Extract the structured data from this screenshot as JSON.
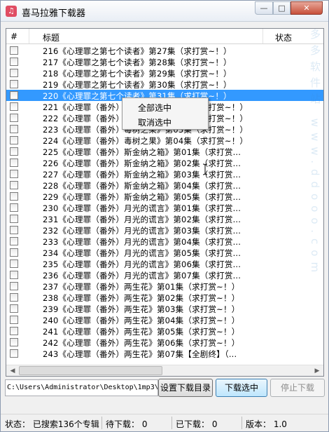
{
  "window": {
    "title": "喜马拉雅下载器",
    "min_label": "—",
    "max_label": "□",
    "close_label": "✕"
  },
  "list": {
    "columns": {
      "index": "#",
      "title": "标题",
      "status": "状态"
    },
    "rows": [
      {
        "text": "216《心理罪之第七个读者》第27集（求打赏~！）",
        "selected": false
      },
      {
        "text": "217《心理罪之第七个读者》第28集（求打赏~！）",
        "selected": false
      },
      {
        "text": "218《心理罪之第七个读者》第29集（求打赏~！）",
        "selected": false
      },
      {
        "text": "219《心理罪之第七个读者》第30集（求打赏~！）",
        "selected": false
      },
      {
        "text": "220《心理罪之第七个读者》第31集（求打赏~！）",
        "selected": true
      },
      {
        "text": "221《心理罪（番外）毒树之果》第01集（求打赏~！）",
        "selected": false
      },
      {
        "text": "222《心理罪（番外）毒树之果》第02集（求打赏~！）",
        "selected": false
      },
      {
        "text": "223《心理罪（番外）毒树之果》第03集（求打赏~！）",
        "selected": false
      },
      {
        "text": "224《心理罪（番外）毒树之果》第04集（求打赏~！）",
        "selected": false
      },
      {
        "text": "225《心理罪（番外）斯金纳之箱》第01集（求打赏...",
        "selected": false
      },
      {
        "text": "226《心理罪（番外）斯金纳之箱》第02集（求打赏...",
        "selected": false
      },
      {
        "text": "227《心理罪（番外）斯金纳之箱》第03集（求打赏...",
        "selected": false
      },
      {
        "text": "228《心理罪（番外）斯金纳之箱》第04集（求打赏...",
        "selected": false
      },
      {
        "text": "229《心理罪（番外）斯金纳之箱》第05集（求打赏...",
        "selected": false
      },
      {
        "text": "230《心理罪（番外）月光的谎言》第01集（求打赏...",
        "selected": false
      },
      {
        "text": "231《心理罪（番外）月光的谎言》第02集（求打赏...",
        "selected": false
      },
      {
        "text": "232《心理罪（番外）月光的谎言》第03集（求打赏...",
        "selected": false
      },
      {
        "text": "233《心理罪（番外）月光的谎言》第04集（求打赏...",
        "selected": false
      },
      {
        "text": "234《心理罪（番外）月光的谎言》第05集（求打赏...",
        "selected": false
      },
      {
        "text": "235《心理罪（番外）月光的谎言》第06集（求打赏...",
        "selected": false
      },
      {
        "text": "236《心理罪（番外）月光的谎言》第07集（求打赏...",
        "selected": false
      },
      {
        "text": "237《心理罪（番外）两生花》第01集（求打赏~！）",
        "selected": false
      },
      {
        "text": "238《心理罪（番外）两生花》第02集（求打赏~！）",
        "selected": false
      },
      {
        "text": "239《心理罪（番外）两生花》第03集（求打赏~！）",
        "selected": false
      },
      {
        "text": "240《心理罪（番外）两生花》第04集（求打赏~！）",
        "selected": false
      },
      {
        "text": "241《心理罪（番外）两生花》第05集（求打赏~！）",
        "selected": false
      },
      {
        "text": "242《心理罪（番外）两生花》第06集（求打赏~！）",
        "selected": false
      },
      {
        "text": "243《心理罪（番外）两生花》第07集【全剧终】（...",
        "selected": false
      }
    ],
    "scroll_left": "◀",
    "scroll_right": "▶"
  },
  "context_menu": {
    "select_all": "全部选中",
    "deselect": "取消选中"
  },
  "toolbar": {
    "path_value": "C:\\Users\\Administrator\\Desktop\\1mp3\\",
    "set_dir_label": "设置下载目录",
    "download_selected_label": "下载选中",
    "stop_label": "停止下载"
  },
  "statusbar": {
    "status_text": "状态： 已搜索136个专辑",
    "pending_text": "待下载： 0",
    "done_text": "已下载： 0",
    "version_text": "版本： 1.0"
  },
  "watermark": "多多软件站 www.ddooo.com",
  "colors": {
    "selection": "#3399ff",
    "accent": "#e04d63"
  }
}
